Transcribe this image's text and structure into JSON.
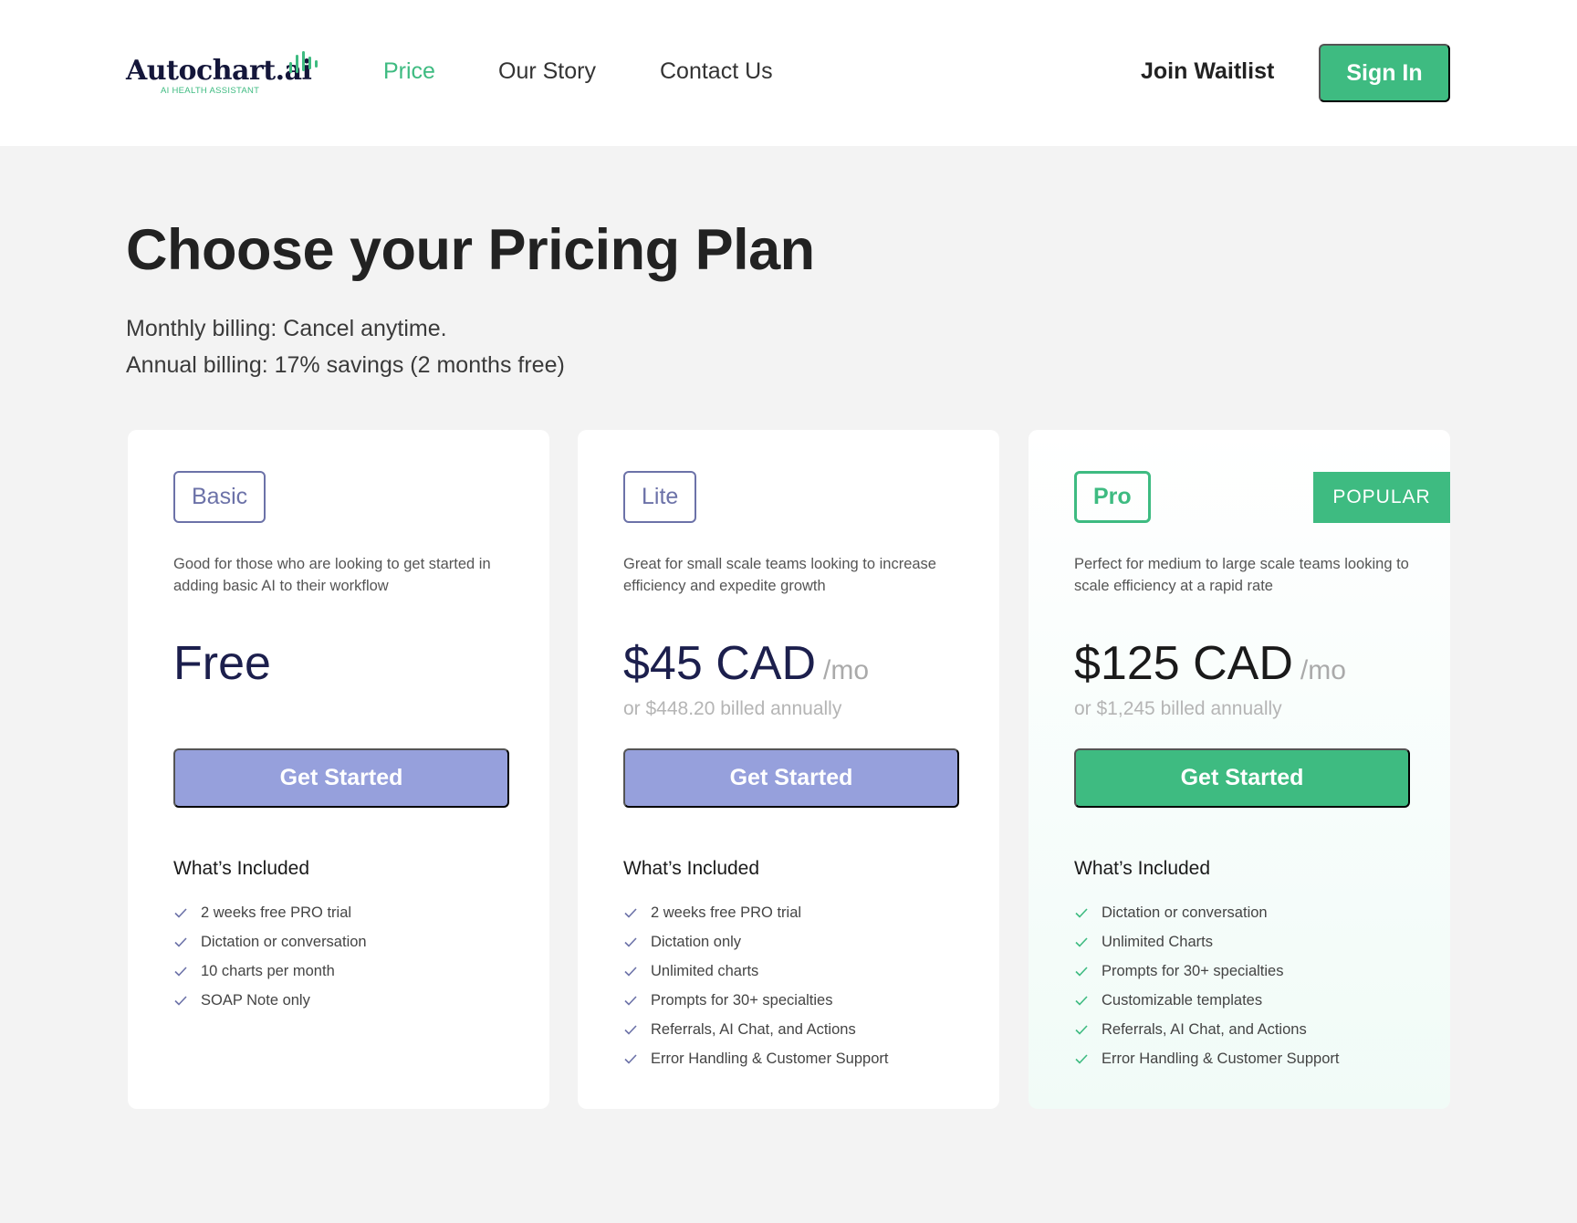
{
  "header": {
    "logo": {
      "name": "Autochart.ai",
      "tagline": "AI HEALTH ASSISTANT"
    },
    "nav": [
      "Price",
      "Our Story",
      "Contact Us"
    ],
    "active_nav": "Price",
    "join_label": "Join Waitlist",
    "signin_label": "Sign In"
  },
  "hero": {
    "title": "Choose your Pricing Plan",
    "line1": "Monthly billing: Cancel anytime.",
    "line2": "Annual billing: 17% savings (2 months free)"
  },
  "colors": {
    "accent": "#3ebb81",
    "indigo": "#6c72a8",
    "button_indigo": "#96a0dc",
    "navy": "#1c1f4d"
  },
  "plans": [
    {
      "name": "Basic",
      "description": "Good for those who are looking to get started in adding basic AI to their workflow",
      "price": "Free",
      "per": "",
      "annual": "",
      "cta": "Get Started",
      "included_title": "What’s Included",
      "features": [
        "2 weeks free PRO trial",
        "Dictation or conversation",
        "10 charts per month",
        "SOAP Note only"
      ]
    },
    {
      "name": "Lite",
      "description": "Great for small scale teams looking to increase efficiency and expedite growth",
      "price": "$45 CAD",
      "per": "/mo",
      "annual": "or $448.20 billed annually",
      "cta": "Get Started",
      "included_title": "What’s Included",
      "features": [
        "2 weeks free PRO trial",
        "Dictation only",
        "Unlimited charts",
        "Prompts for 30+ specialties",
        "Referrals, AI Chat, and Actions",
        "Error Handling & Customer Support"
      ]
    },
    {
      "name": "Pro",
      "badge": "POPULAR",
      "description": "Perfect for medium to large scale teams looking to scale efficiency at a rapid rate",
      "price": "$125 CAD",
      "per": "/mo",
      "annual": "or $1,245 billed annually",
      "cta": "Get Started",
      "included_title": "What’s Included",
      "features": [
        "Dictation or conversation",
        "Unlimited Charts",
        "Prompts for 30+ specialties",
        "Customizable templates",
        "Referrals, AI Chat, and Actions",
        "Error Handling & Customer Support"
      ]
    }
  ]
}
